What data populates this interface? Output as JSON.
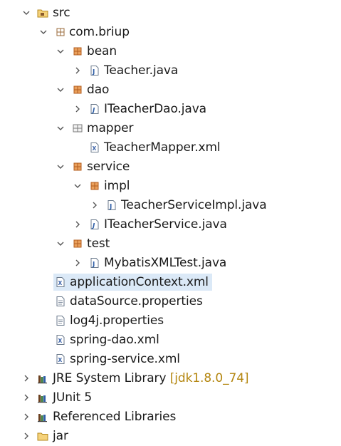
{
  "tree": {
    "src": {
      "label": "src"
    },
    "pkg_root": {
      "label": "com.briup"
    },
    "pkg_bean": {
      "label": "bean"
    },
    "file_teacher": {
      "label": "Teacher.java"
    },
    "pkg_dao": {
      "label": "dao"
    },
    "file_iteacherdao": {
      "label": "ITeacherDao.java"
    },
    "pkg_mapper": {
      "label": "mapper"
    },
    "file_teachermapper": {
      "label": "TeacherMapper.xml"
    },
    "pkg_service": {
      "label": "service"
    },
    "pkg_impl": {
      "label": "impl"
    },
    "file_teacherserviceimpl": {
      "label": "TeacherServiceImpl.java"
    },
    "file_iteacherservice": {
      "label": "ITeacherService.java"
    },
    "pkg_test": {
      "label": "test"
    },
    "file_mybatistest": {
      "label": "MybatisXMLTest.java"
    },
    "file_appcontext": {
      "label": "applicationContext.xml"
    },
    "file_datasource": {
      "label": "dataSource.properties"
    },
    "file_log4j": {
      "label": "log4j.properties"
    },
    "file_springdao": {
      "label": "spring-dao.xml"
    },
    "file_springservice": {
      "label": "spring-service.xml"
    },
    "lib_jre": {
      "label": "JRE System Library",
      "decoration": "[jdk1.8.0_74]"
    },
    "lib_junit": {
      "label": "JUnit 5"
    },
    "lib_referenced": {
      "label": "Referenced Libraries"
    },
    "folder_jar": {
      "label": "jar"
    }
  },
  "colors": {
    "selection": "#dbe9f7",
    "decoration": "#b4860f",
    "twistie": "#555555",
    "package_icon": "#b35c1e",
    "folder_icon": "#e2b23c"
  }
}
